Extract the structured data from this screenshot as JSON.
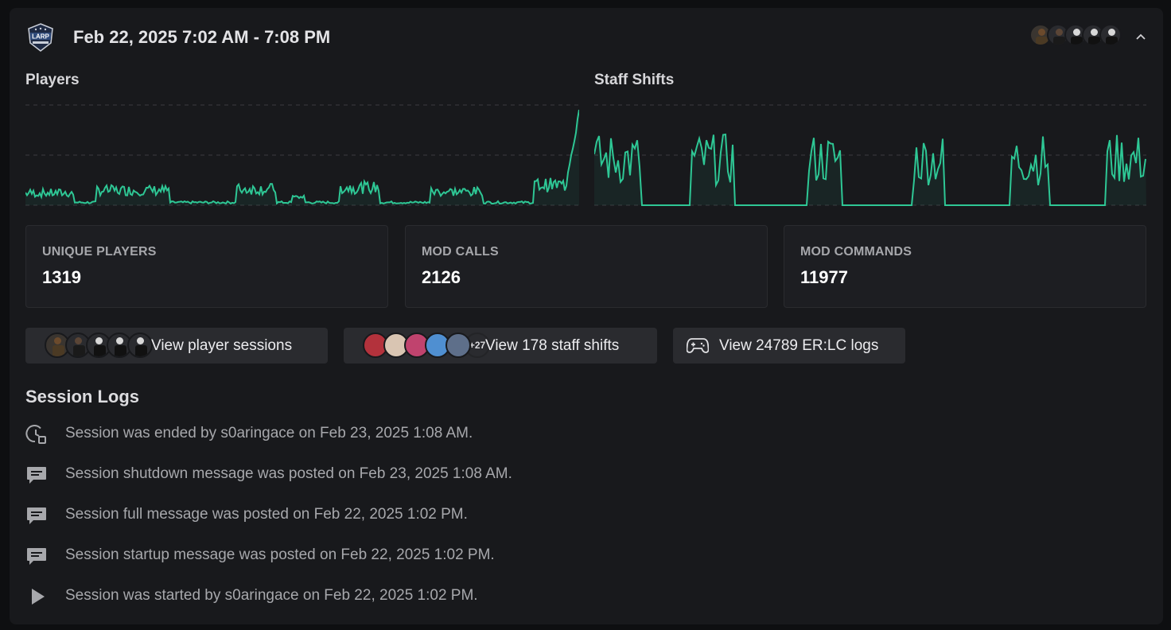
{
  "header": {
    "title": "Feb 22, 2025 7:02 AM - 7:08 PM",
    "logo_text": "LARP",
    "avatars": [
      "#6b4a2c",
      "#3a3a3a",
      "#2b2b2b",
      "#2b2b2b",
      "#2b2b2b"
    ]
  },
  "charts": {
    "players_label": "Players",
    "staff_label": "Staff Shifts",
    "accent_color": "#2ec795"
  },
  "stats": [
    {
      "label": "UNIQUE PLAYERS",
      "value": "1319"
    },
    {
      "label": "MOD CALLS",
      "value": "2126"
    },
    {
      "label": "MOD COMMANDS",
      "value": "11977"
    }
  ],
  "actions": {
    "player_sessions": "View player sessions",
    "staff_shifts": "View 178 staff shifts",
    "staff_extra": "+27",
    "erlc_logs": "View 24789 ER:LC logs"
  },
  "session_logs": {
    "title": "Session Logs",
    "items": [
      {
        "icon": "clock-stop-icon",
        "text": "Session was ended by s0aringace on Feb 23, 2025 1:08 AM."
      },
      {
        "icon": "message-icon",
        "text": "Session shutdown message was posted on Feb 23, 2025 1:08 AM."
      },
      {
        "icon": "message-icon",
        "text": "Session full message was posted on Feb 22, 2025 1:02 PM."
      },
      {
        "icon": "message-icon",
        "text": "Session startup message was posted on Feb 22, 2025 1:02 PM."
      },
      {
        "icon": "play-icon",
        "text": "Session was started by s0aringace on Feb 22, 2025 1:02 PM."
      }
    ]
  }
}
